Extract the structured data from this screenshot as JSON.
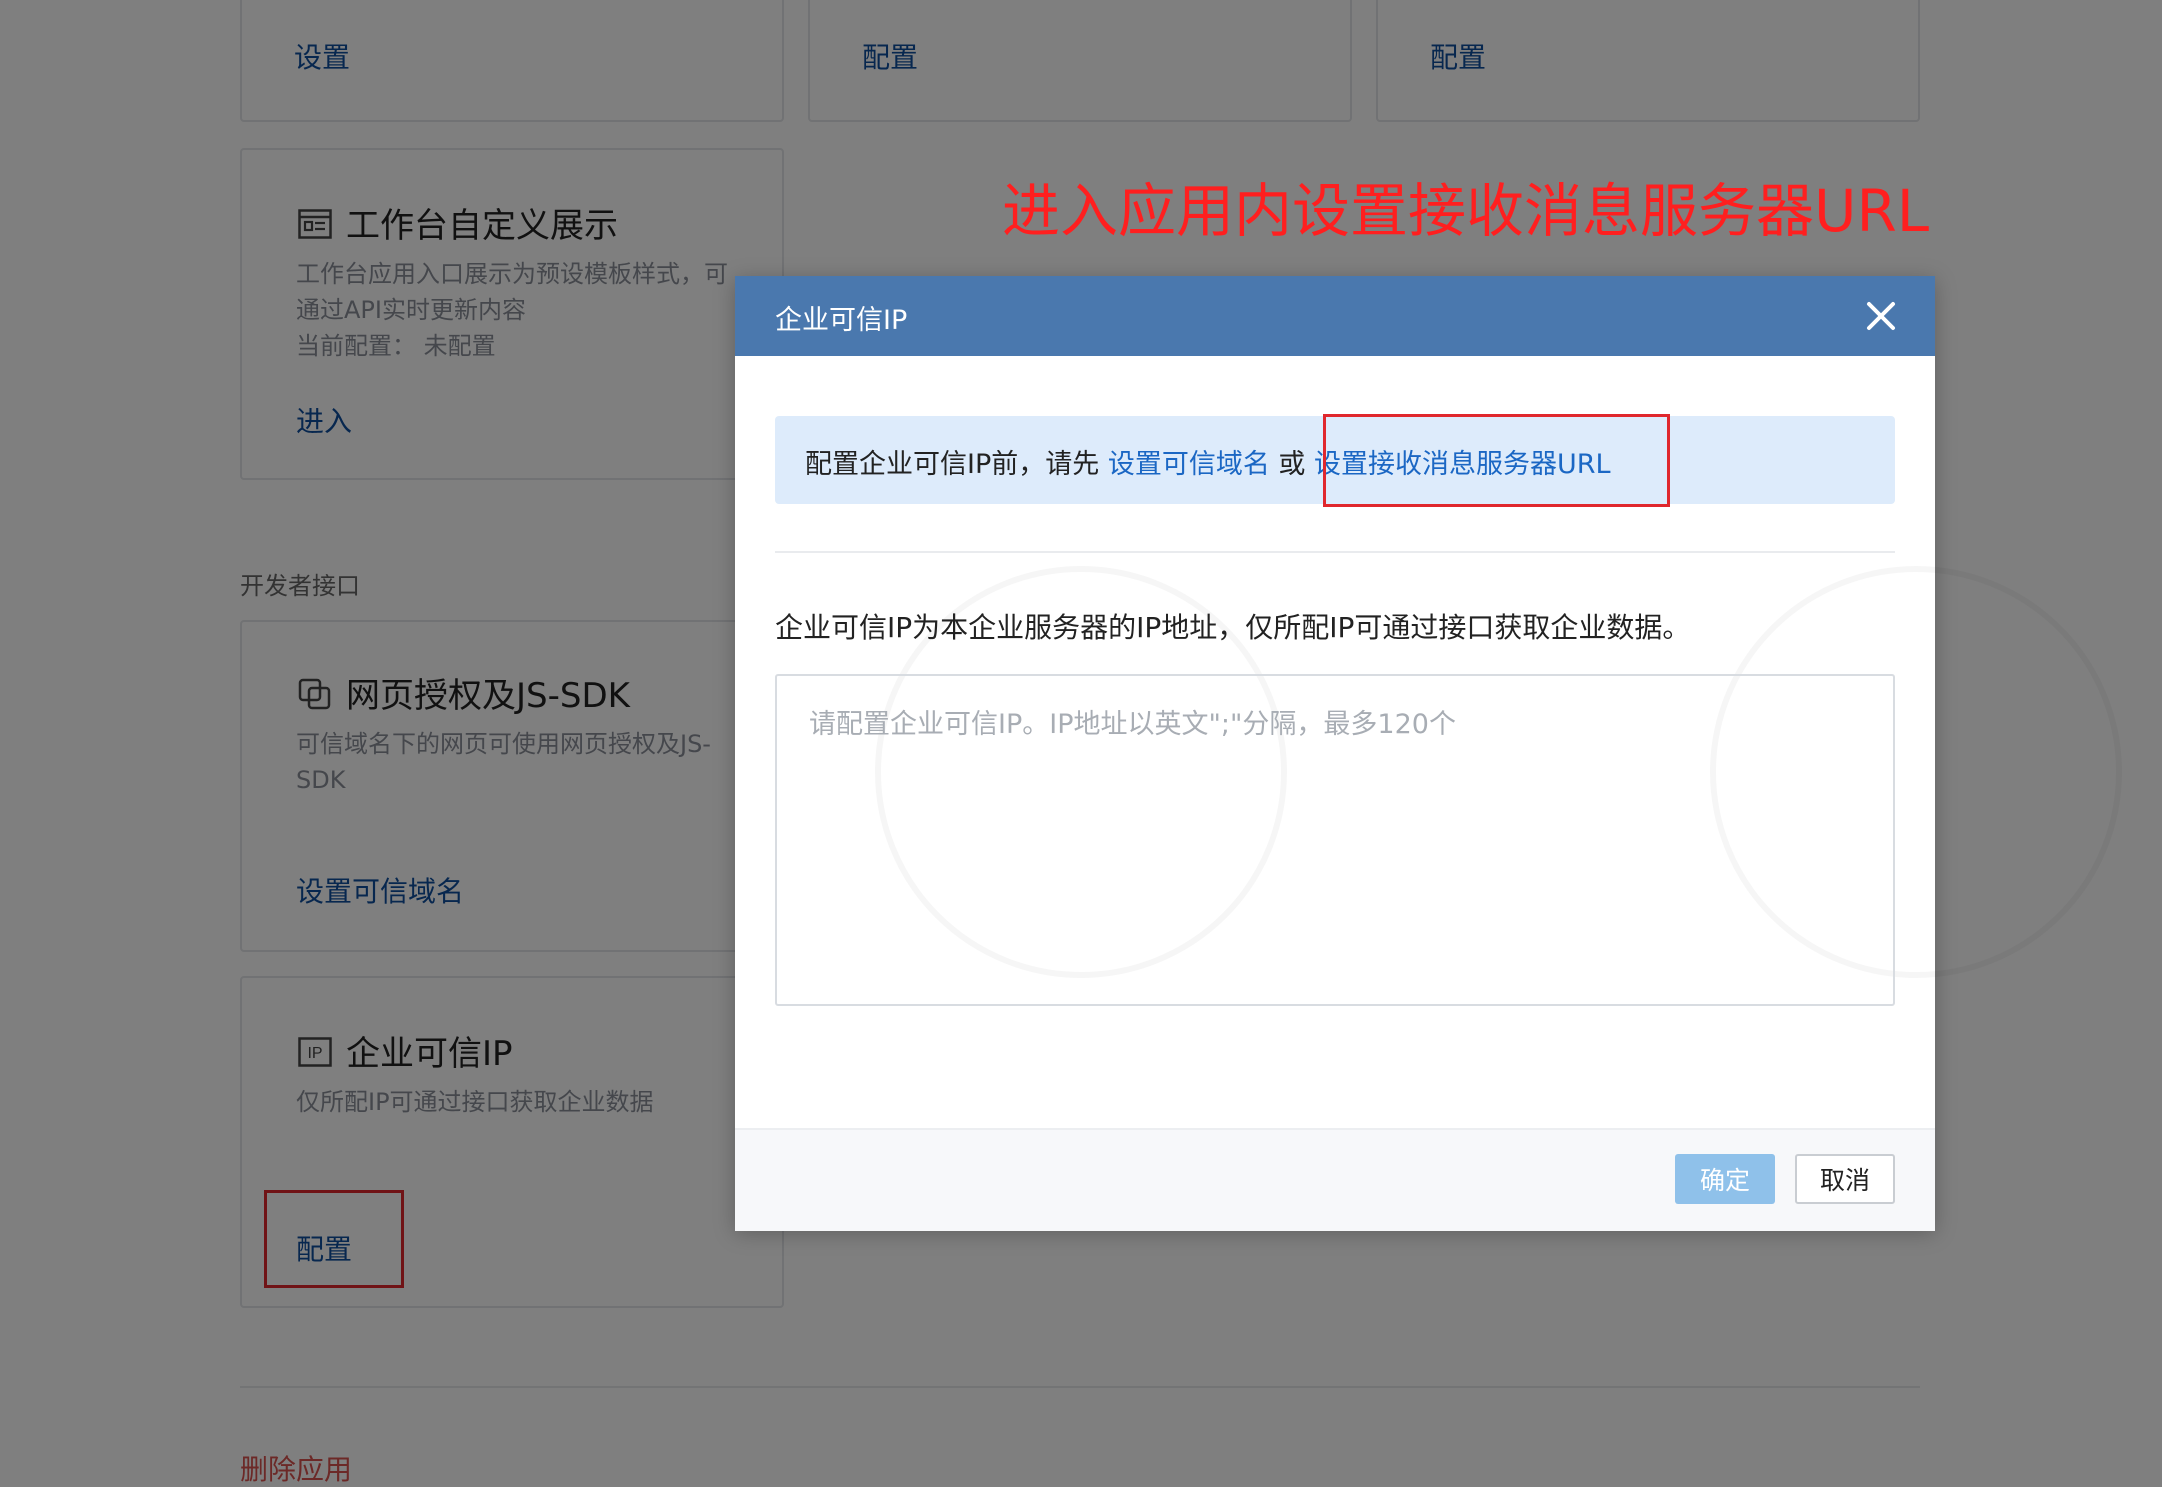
{
  "background": {
    "top_cards": [
      {
        "link": "设置"
      },
      {
        "link": "配置"
      },
      {
        "link": "配置"
      }
    ],
    "workbench_card": {
      "icon": "display-card-icon",
      "title": "工作台自定义展示",
      "desc_line1": "工作台应用入口展示为预设模板样式，可",
      "desc_line2": "通过API实时更新内容",
      "current_config": "当前配置：  未配置",
      "link": "进入"
    },
    "section_label": "开发者接口",
    "webauth_card": {
      "icon": "copy-frames-icon",
      "title": "网页授权及JS-SDK",
      "desc_line1": "可信域名下的网页可使用网页授权及JS-",
      "desc_line2": "SDK",
      "link": "设置可信域名"
    },
    "trusted_ip_card": {
      "icon": "ip-icon",
      "icon_text": "IP",
      "title": "企业可信IP",
      "desc": "仅所配IP可通过接口获取企业数据",
      "link": "配置"
    },
    "delete_link": "删除应用"
  },
  "annotation": {
    "text": "进入应用内设置接收消息服务器URL",
    "color": "#ff1f1f"
  },
  "modal": {
    "title": "企业可信IP",
    "close_icon": "close-icon",
    "notice": {
      "prefix": "配置企业可信IP前，请先 ",
      "link1": "设置可信域名",
      "middle": " 或 ",
      "link2": "设置接收消息服务器URL"
    },
    "description": "企业可信IP为本企业服务器的IP地址，仅所配IP可通过接口获取企业数据。",
    "textarea_placeholder": "请配置企业可信IP。IP地址以英文\";\"分隔，最多120个",
    "confirm_label": "确定",
    "cancel_label": "取消"
  },
  "colors": {
    "header": "#4a78ae",
    "link": "#1b67c4",
    "annotation_red": "#e0272d",
    "confirm_disabled": "#8fc1ea"
  }
}
